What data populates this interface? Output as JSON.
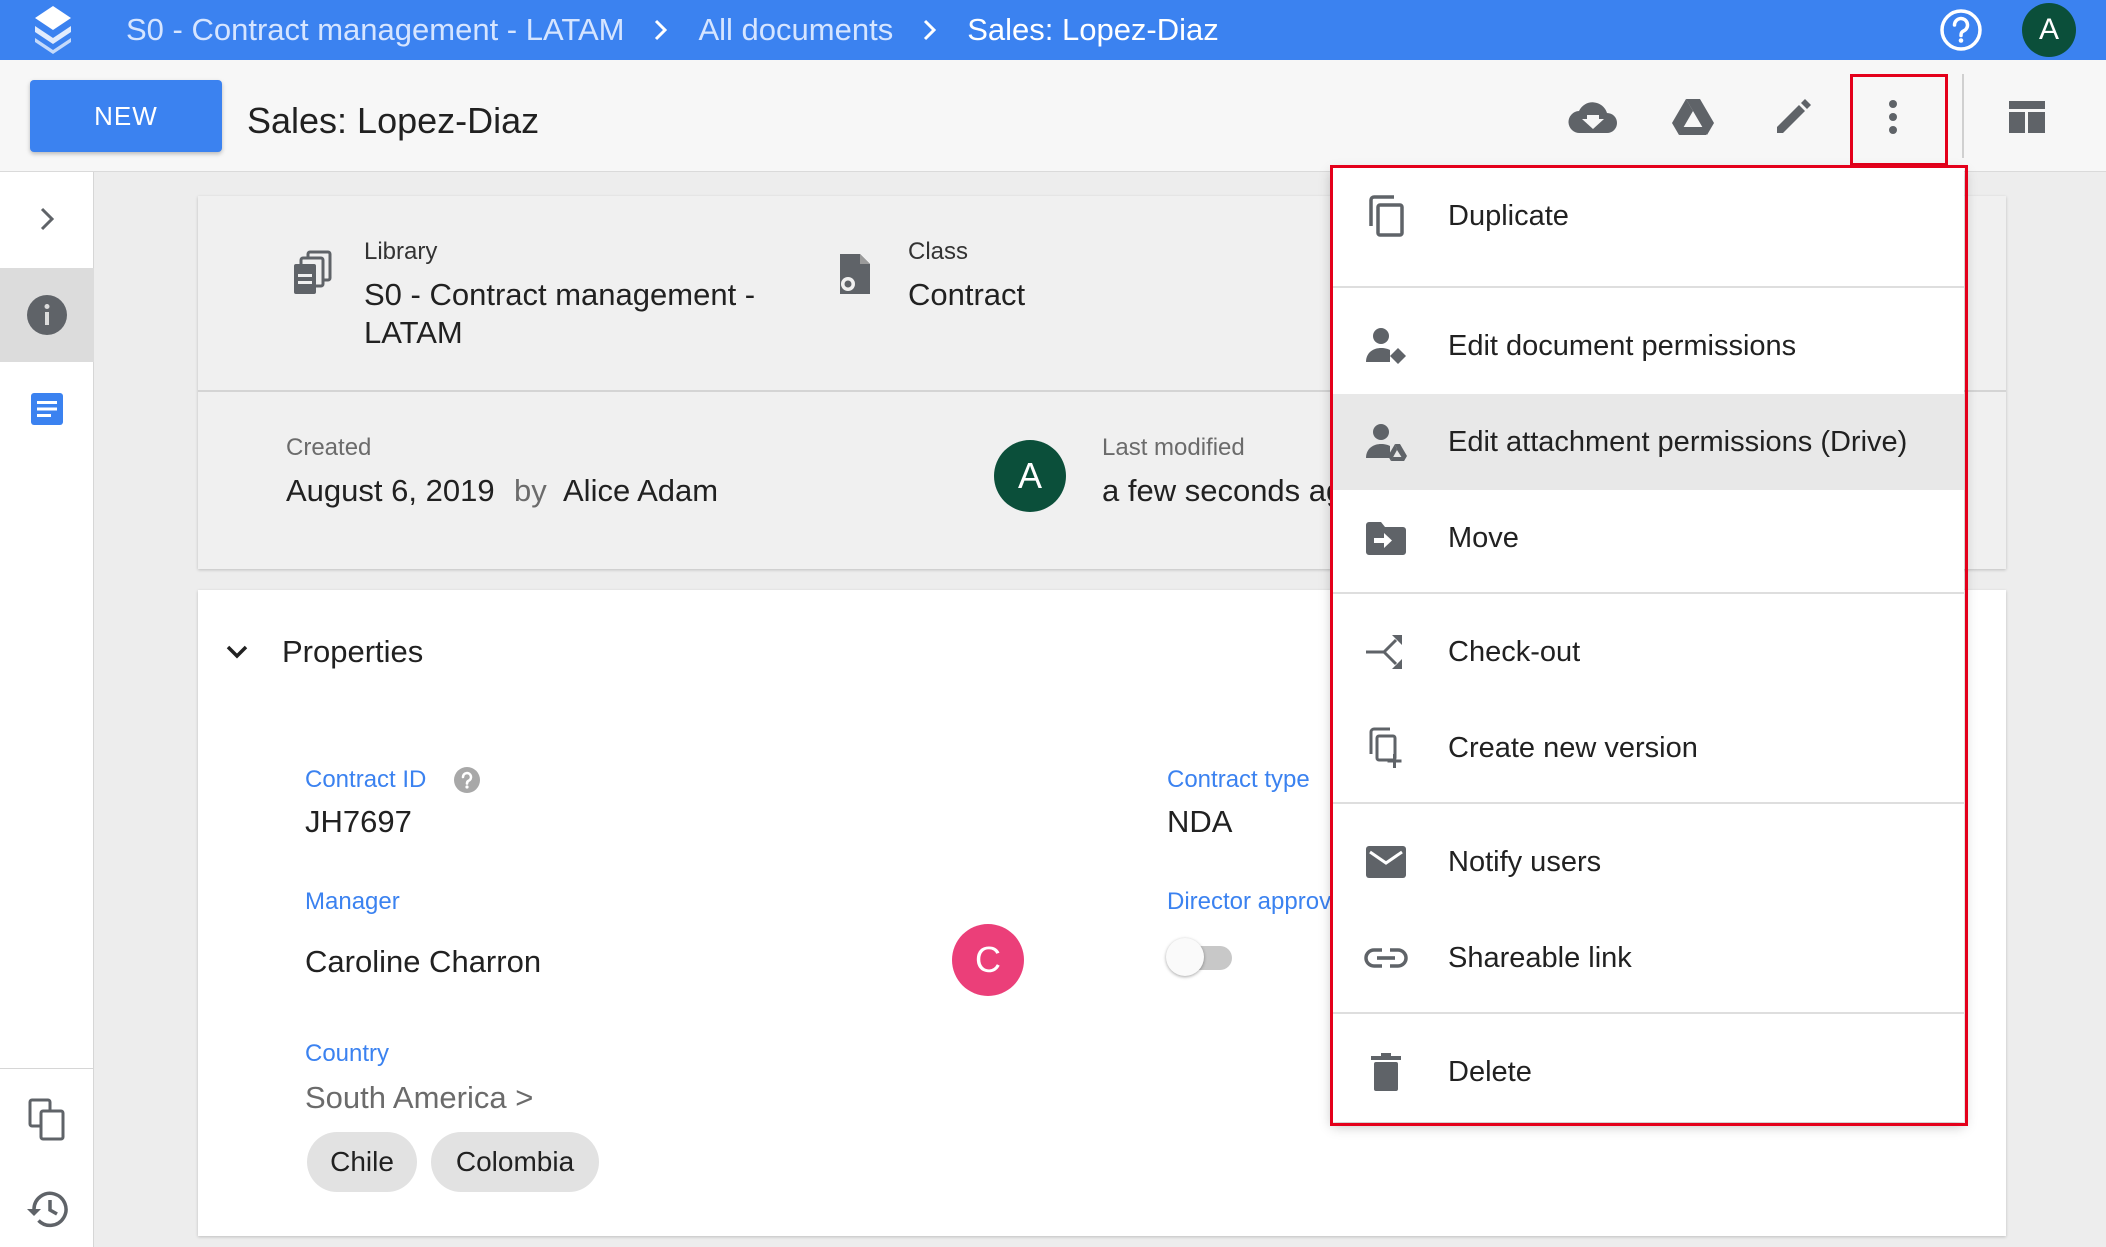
{
  "topbar": {
    "breadcrumbs": [
      "S0 - Contract management - LATAM",
      "All documents",
      "Sales: Lopez-Diaz"
    ],
    "user_initial": "A",
    "color": "#3b82f0"
  },
  "toolbar": {
    "new_label": "NEW",
    "doc_title": "Sales: Lopez-Diaz",
    "icons": [
      "download-icon",
      "drive-icon",
      "edit-icon",
      "more-vert-icon",
      "layout-icon"
    ]
  },
  "info": {
    "library_label": "Library",
    "library_value_line1": "S0 - Contract management -",
    "library_value_line2": "LATAM",
    "class_label": "Class",
    "class_value": "Contract",
    "created_label": "Created",
    "created_date": "August 6, 2019",
    "by_label": "by",
    "created_by": "Alice Adam",
    "creator_initial": "A",
    "modified_label": "Last modified",
    "modified_value": "a few seconds ago"
  },
  "properties": {
    "section_title": "Properties",
    "contract_id_label": "Contract ID",
    "contract_id_value": "JH7697",
    "contract_type_label": "Contract type",
    "contract_type_value": "NDA",
    "manager_label": "Manager",
    "manager_value": "Caroline Charron",
    "manager_initial": "C",
    "director_label": "Director approval",
    "director_approval_on": false,
    "country_label": "Country",
    "country_path": "South America >",
    "countries": [
      "Chile",
      "Colombia"
    ]
  },
  "menu": {
    "items": [
      {
        "label": "Duplicate",
        "icon": "duplicate-icon"
      },
      {
        "label": "Edit document permissions",
        "icon": "person-permissions-icon"
      },
      {
        "label": "Edit attachment permissions (Drive)",
        "icon": "person-drive-icon"
      },
      {
        "label": "Move",
        "icon": "move-folder-icon"
      },
      {
        "label": "Check-out",
        "icon": "checkout-icon"
      },
      {
        "label": "Create new version",
        "icon": "new-version-icon"
      },
      {
        "label": "Notify users",
        "icon": "mail-icon"
      },
      {
        "label": "Shareable link",
        "icon": "link-icon"
      },
      {
        "label": "Delete",
        "icon": "delete-icon"
      }
    ],
    "highlight_color": "#e4001b"
  }
}
